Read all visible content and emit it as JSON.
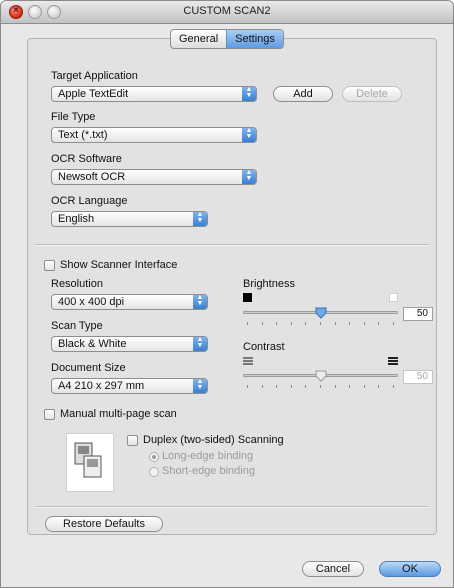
{
  "window": {
    "title": "CUSTOM SCAN2"
  },
  "tabs": [
    {
      "label": "General",
      "selected": false
    },
    {
      "label": "Settings",
      "selected": true
    }
  ],
  "target_application": {
    "label": "Target Application",
    "value": "Apple TextEdit",
    "add_label": "Add",
    "delete_label": "Delete"
  },
  "file_type": {
    "label": "File Type",
    "value": "Text (*.txt)"
  },
  "ocr_software": {
    "label": "OCR Software",
    "value": "Newsoft OCR"
  },
  "ocr_language": {
    "label": "OCR Language",
    "value": "English"
  },
  "show_scanner_interface": {
    "label": "Show Scanner Interface",
    "checked": false
  },
  "resolution": {
    "label": "Resolution",
    "value": "400 x 400 dpi"
  },
  "scan_type": {
    "label": "Scan Type",
    "value": "Black & White"
  },
  "document_size": {
    "label": "Document Size",
    "value": "A4  210 x 297 mm"
  },
  "brightness": {
    "label": "Brightness",
    "value": "50",
    "level": 0.5
  },
  "contrast": {
    "label": "Contrast",
    "value": "50",
    "level": 0.5,
    "enabled": false
  },
  "manual_multi_page": {
    "label": "Manual multi-page scan",
    "checked": false
  },
  "duplex": {
    "label": "Duplex (two-sided) Scanning",
    "checked": false,
    "options": [
      {
        "label": "Long-edge binding",
        "selected": true
      },
      {
        "label": "Short-edge binding",
        "selected": false
      }
    ]
  },
  "buttons": {
    "restore_defaults": "Restore Defaults",
    "cancel": "Cancel",
    "ok": "OK"
  },
  "colors": {
    "accent": "#5e9ce3",
    "panel": "#e2e2e2",
    "close_light": "#d9341f"
  }
}
